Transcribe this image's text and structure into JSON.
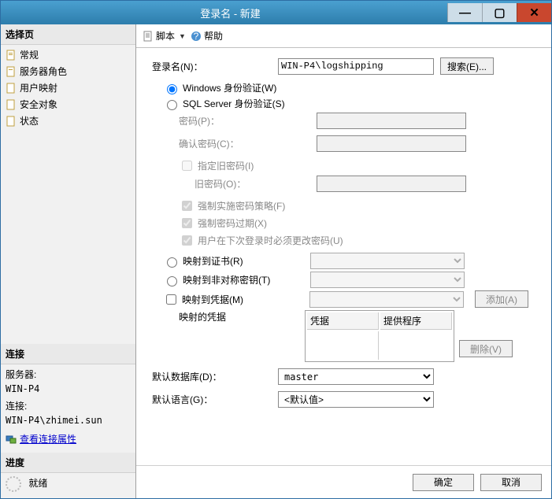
{
  "window": {
    "title": "登录名 - 新建"
  },
  "sidebar": {
    "select_page": "选择页",
    "items": [
      {
        "label": "常规"
      },
      {
        "label": "服务器角色"
      },
      {
        "label": "用户映射"
      },
      {
        "label": "安全对象"
      },
      {
        "label": "状态"
      }
    ],
    "connection": {
      "title": "连接",
      "server_label": "服务器:",
      "server_value": "WIN-P4",
      "conn_label": "连接:",
      "conn_value": "WIN-P4\\zhimei.sun",
      "view_props": "查看连接属性"
    },
    "progress": {
      "title": "进度",
      "status": "就绪"
    }
  },
  "toolbar": {
    "script": "脚本",
    "help": "帮助"
  },
  "form": {
    "login_label": "登录名(N)：",
    "login_value": "WIN-P4\\logshipping",
    "search_btn": "搜索(E)...",
    "auth_win": "Windows 身份验证(W)",
    "auth_sql": "SQL Server 身份验证(S)",
    "password_label": "密码(P)：",
    "confirm_label": "确认密码(C)：",
    "specify_old": "指定旧密码(I)",
    "old_password_label": "旧密码(O)：",
    "enforce_policy": "强制实施密码策略(F)",
    "enforce_expire": "强制密码过期(X)",
    "must_change": "用户在下次登录时必须更改密码(U)",
    "map_cert": "映射到证书(R)",
    "map_asym": "映射到非对称密钥(T)",
    "map_cred": "映射到凭据(M)",
    "add_btn": "添加(A)",
    "mapped_cred": "映射的凭据",
    "cred_col1": "凭据",
    "cred_col2": "提供程序",
    "remove_btn": "删除(V)",
    "default_db_label": "默认数据库(D)：",
    "default_db_value": "master",
    "default_lang_label": "默认语言(G)：",
    "default_lang_value": "<默认值>"
  },
  "buttons": {
    "ok": "确定",
    "cancel": "取消"
  }
}
